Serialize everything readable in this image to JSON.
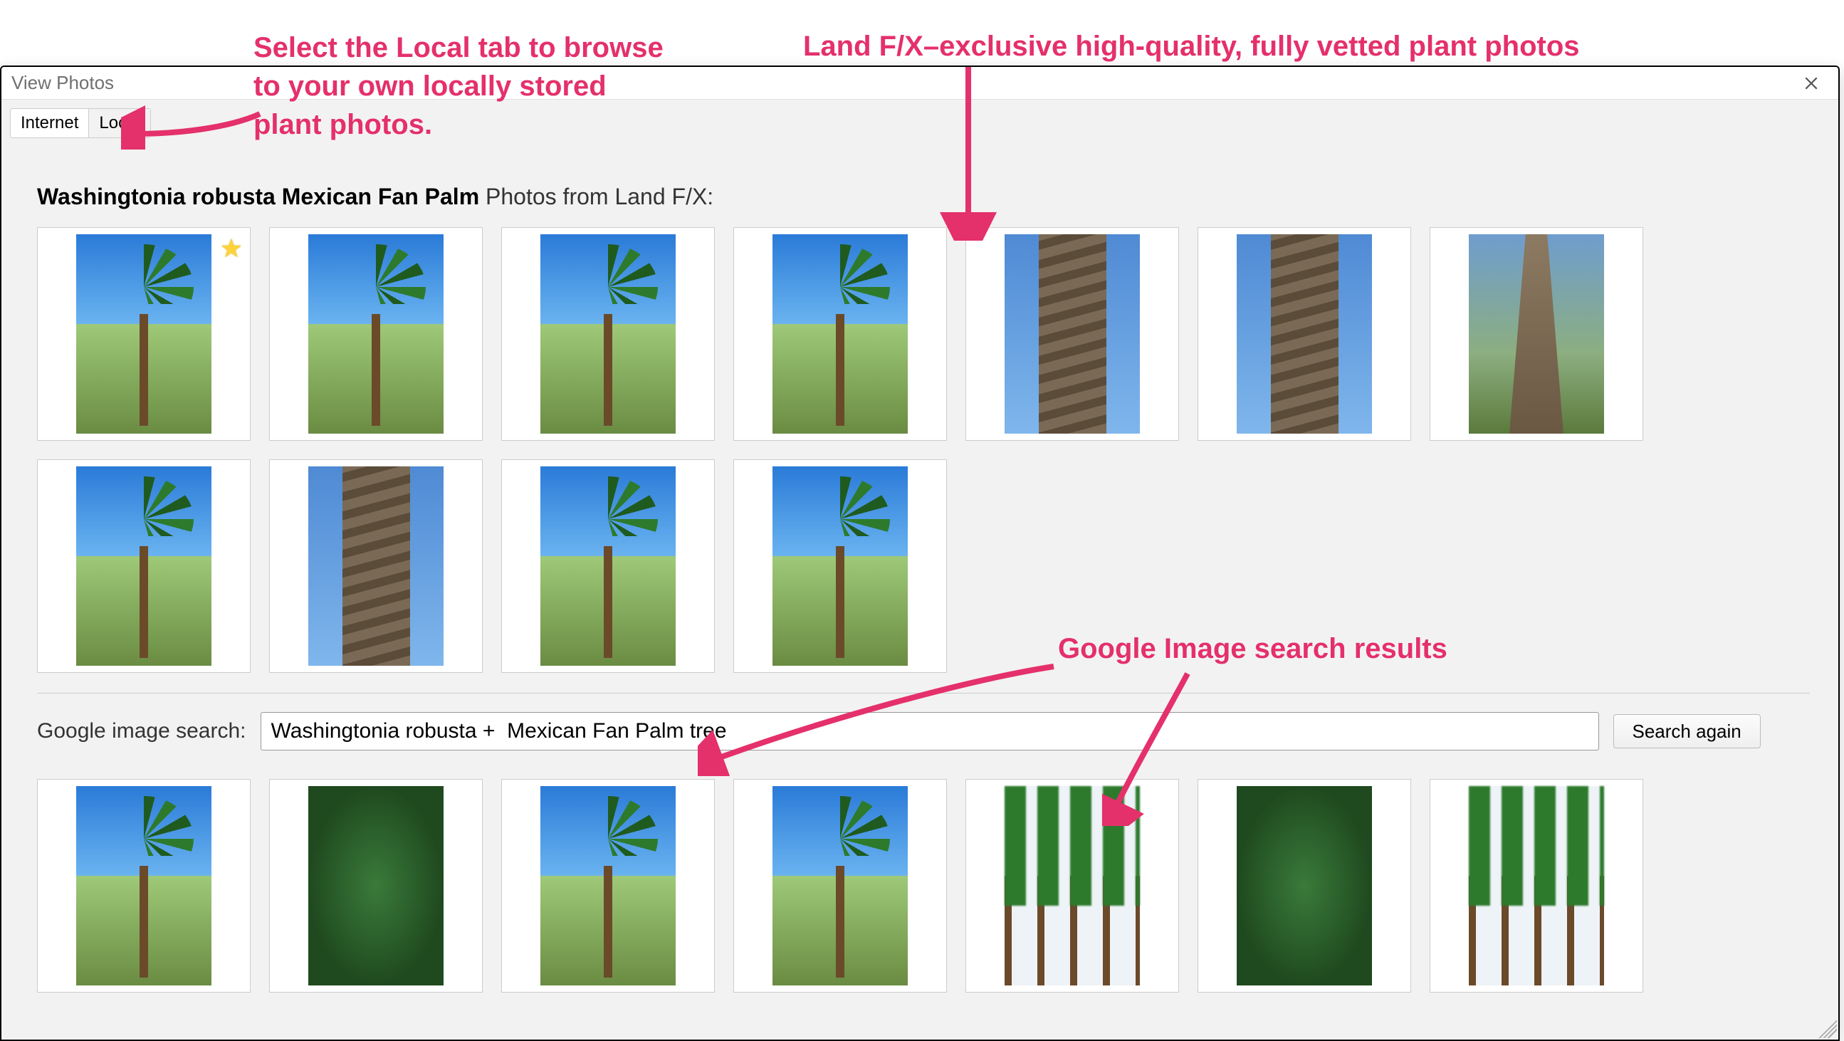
{
  "annotations": {
    "local_tab": "Select the Local tab to browse\nto your own locally stored\nplant photos.",
    "landfx_photos": "Land F/X–exclusive high-quality, fully vetted plant photos",
    "google_results": "Google Image search results"
  },
  "dialog": {
    "title": "View Photos",
    "tabs": {
      "internet": "Internet",
      "local": "Local"
    },
    "heading_bold": "Washingtonia robusta Mexican Fan Palm",
    "heading_rest": " Photos from Land F/X:",
    "landfx_thumbs": [
      {
        "name": "palm-full-1",
        "style": "palm-full",
        "starred": true
      },
      {
        "name": "palm-street-2",
        "style": "palm-full"
      },
      {
        "name": "palm-mountains-3",
        "style": "palm-full"
      },
      {
        "name": "palm-city-4",
        "style": "palm-full"
      },
      {
        "name": "palm-trunk-5",
        "style": "palm-trunk"
      },
      {
        "name": "palm-trunk-fiber-6",
        "style": "palm-trunk"
      },
      {
        "name": "palm-base-7",
        "style": "palm-base"
      },
      {
        "name": "palm-full-8",
        "style": "palm-full"
      },
      {
        "name": "palm-crown-9",
        "style": "palm-trunk"
      },
      {
        "name": "palm-grove-10",
        "style": "palm-full"
      },
      {
        "name": "palm-avenue-11",
        "style": "palm-full"
      }
    ],
    "search": {
      "label": "Google image search:",
      "value": "Washingtonia robusta +  Mexican Fan Palm tree",
      "button": "Search again"
    },
    "google_thumbs": [
      {
        "name": "g-palm-1",
        "style": "palm-full"
      },
      {
        "name": "g-palm-2",
        "style": "palm-branches"
      },
      {
        "name": "g-palm-group-3",
        "style": "palm-full"
      },
      {
        "name": "g-palm-4",
        "style": "palm-full"
      },
      {
        "name": "g-palm-row-5",
        "style": "palm-row"
      },
      {
        "name": "g-palm-leaves-6",
        "style": "palm-branches"
      },
      {
        "name": "g-palm-silhouettes-7",
        "style": "palm-row"
      }
    ]
  }
}
